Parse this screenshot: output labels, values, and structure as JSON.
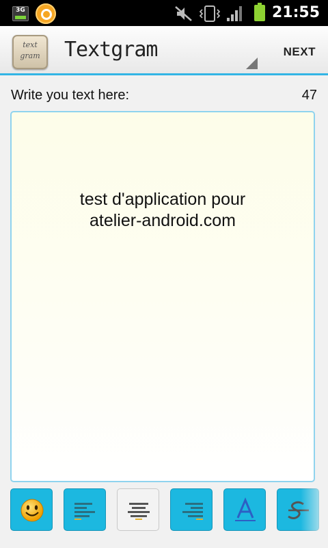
{
  "status_bar": {
    "network": "3G",
    "time": "21:55",
    "icons": [
      "3g-icon",
      "app-notification-icon",
      "mute-icon",
      "vibrate-icon",
      "signal-icon",
      "battery-icon"
    ]
  },
  "action_bar": {
    "app_icon_text": [
      "text",
      "gram"
    ],
    "title": "Textgram",
    "next_label": "NEXT",
    "accent_color": "#33b5e5"
  },
  "editor": {
    "label": "Write you text here:",
    "char_count": "47",
    "text": "test d'application pour\natelier-android.com"
  },
  "toolbar": {
    "buttons": [
      {
        "name": "emoji",
        "icon": "smiley-icon",
        "selected": true
      },
      {
        "name": "align-left",
        "icon": "align-left-icon",
        "selected": true
      },
      {
        "name": "align-center",
        "icon": "align-center-icon",
        "selected": false
      },
      {
        "name": "align-right",
        "icon": "align-right-icon",
        "selected": true
      },
      {
        "name": "font",
        "icon": "font-a-icon",
        "selected": true
      },
      {
        "name": "strike",
        "icon": "strike-icon",
        "selected": true
      }
    ],
    "button_color": "#1cb8e0"
  }
}
